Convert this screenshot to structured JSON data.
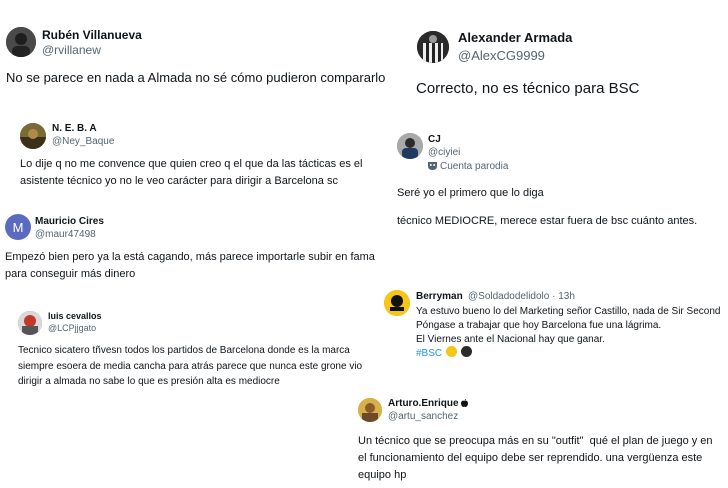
{
  "tweets": [
    {
      "name": "Rubén Villanueva",
      "handle": "@rvillanew",
      "text": "No se parece en nada a Almada no sé cómo pudieron compararlo"
    },
    {
      "name": "N. E. B. A",
      "handle": "@Ney_Baque",
      "text": "Lo dije q no me convence que quien creo q el que da las tácticas es el asistente técnico yo no le veo carácter para dirigir a Barcelona sc"
    },
    {
      "name": "Mauricio Cires",
      "handle": "@maur47498",
      "avatar_letter": "M",
      "avatar_color": "#5b6bc0",
      "text": "Empezó bien pero ya la está cagando, más parece importarle subir en fama para conseguir más dinero"
    },
    {
      "name": "luis cevallos",
      "handle": "@LCPjjgato",
      "text": "Tecnico sicatero tñvesn todos los partidos de Barcelona donde es la marca siempre esoera de media cancha para atrás parece que nunca este grone vio dirigir a almada no sabe lo que es presión alta es mediocre"
    },
    {
      "name": "Alexander Armada",
      "handle": "@AlexCG9999",
      "text": "Correcto, no es técnico para BSC"
    },
    {
      "name": "CJ",
      "handle": "@ciyiei",
      "parody_label": "Cuenta parodia",
      "text_line1": "Seré yo el primero que lo diga",
      "text_line2": "técnico MEDIOCRE, merece estar fuera de bsc cuánto antes."
    },
    {
      "name": "Berryman",
      "handle": "@Soldadodelidolo · 13h",
      "line1": "Ya estuvo bueno lo del Marketing señor Castillo, nada de Sir Second",
      "line2": "Póngase a trabajar que hoy Barcelona fue una lágrima.",
      "line3": "El Viernes ante el Nacional hay que ganar.",
      "hashtag": "#BSC",
      "emoji_colors": [
        "#f5c518",
        "#2b2b2b"
      ]
    },
    {
      "name": "Arturo.Enrique",
      "name_suffix": "",
      "handle": "@artu_sanchez",
      "text": "Un técnico que se preocupa más en su \"outfit\"  qué el plan de juego y en el funcionamiento del equipo debe ser reprendido. una vergüenza este equipo hp"
    }
  ],
  "colors": {
    "text": "#0f1419",
    "handle": "#536471",
    "hashtag": "#1d9bf0"
  },
  "icons": [
    "apple-icon",
    "parody-mask-icon"
  ]
}
